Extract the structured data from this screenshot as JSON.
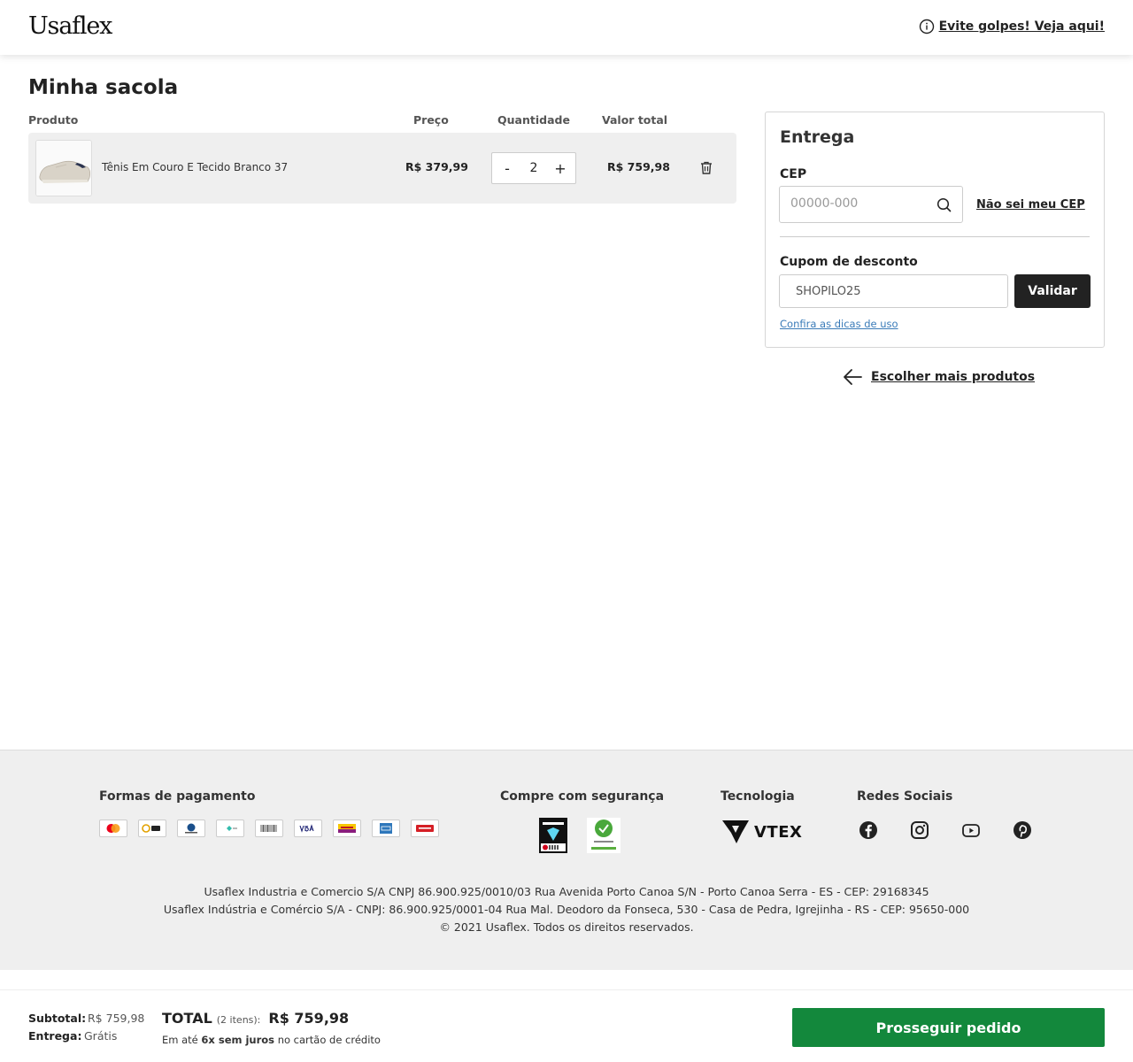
{
  "header": {
    "logo": "Usaflex",
    "scam_warning": "Evite golpes! Veja aqui!"
  },
  "page_title": "Minha sacola",
  "table": {
    "headers": {
      "product": "Produto",
      "price": "Preço",
      "quantity": "Quantidade",
      "total": "Valor total"
    },
    "items": [
      {
        "name": "Tênis Em Couro E Tecido Branco 37",
        "price": "R$ 379,99",
        "quantity": "2",
        "total": "R$ 759,98",
        "minus": "-",
        "plus": "+"
      }
    ]
  },
  "delivery": {
    "title": "Entrega",
    "cep_label": "CEP",
    "cep_placeholder": "00000-000",
    "cep_value": "",
    "cep_help": "Não sei meu CEP",
    "coupon_label": "Cupom de desconto",
    "coupon_value": "SHOPILO25",
    "validate": "Validar",
    "coupon_tips": "Confira as dicas de uso"
  },
  "more_products": "Escolher mais produtos",
  "footer": {
    "payment_title": "Formas de pagamento",
    "payment_methods": [
      "mastercard",
      "elo",
      "diners",
      "pix",
      "boleto",
      "VISA",
      "hipercard",
      "amex",
      "hiper"
    ],
    "security_title": "Compre com segurança",
    "security_badges": [
      "ebit",
      "RA 1000"
    ],
    "technology_title": "Tecnologia",
    "technology": "VTEX",
    "social_title": "Redes Sociais",
    "legal": [
      "Usaflex Industria e Comercio S/A CNPJ 86.900.925/0010/03 Rua Avenida Porto Canoa S/N - Porto Canoa Serra - ES - CEP: 29168345",
      "Usaflex Indústria e Comércio S/A - CNPJ: 86.900.925/0001-04 Rua Mal. Deodoro da Fonseca, 530 - Casa de Pedra, Igrejinha - RS - CEP: 95650-000",
      "© 2021 Usaflex. Todos os direitos reservados."
    ]
  },
  "summary": {
    "subtotal_label": "Subtotal:",
    "subtotal_value": "R$ 759,98",
    "shipping_label": "Entrega:",
    "shipping_value": "Grátis",
    "total_label": "TOTAL",
    "total_items": "(2 itens):",
    "total_value": "R$ 759,98",
    "installments_prefix": "Em até",
    "installments_bold": "6x sem juros",
    "installments_suffix": "no cartão de crédito",
    "proceed": "Prosseguir pedido"
  },
  "colors": {
    "primary_button": "#13883c",
    "dark_button": "#222222",
    "link_blue": "#3a7bb8"
  }
}
